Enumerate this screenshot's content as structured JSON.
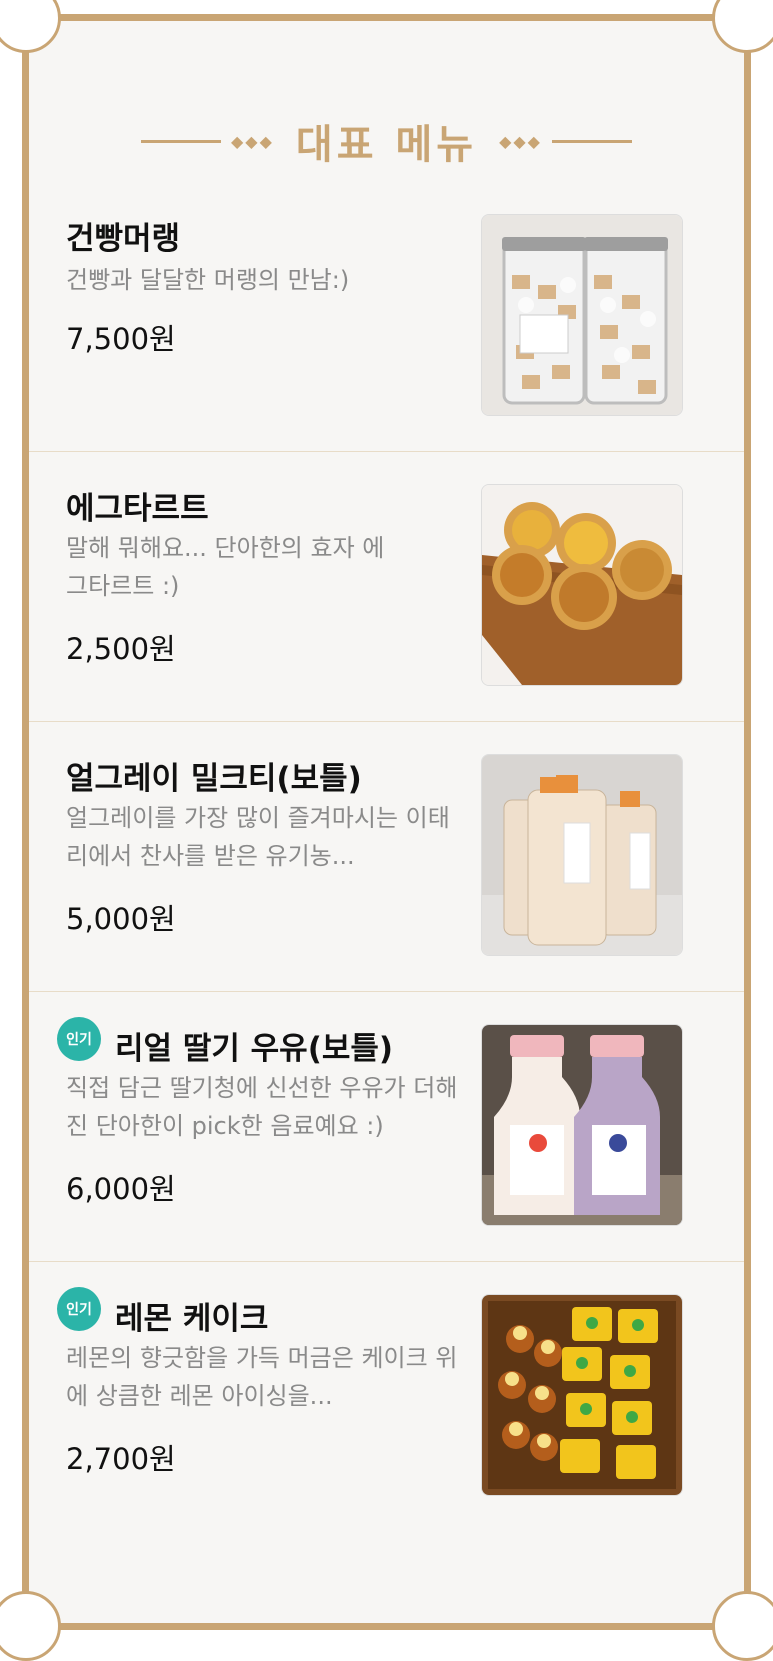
{
  "header": {
    "title": "대표 메뉴",
    "ornament_left": "◆◆◆",
    "ornament_right": "◆◆◆"
  },
  "badge_label": "인기",
  "items": [
    {
      "name": "건빵머랭",
      "desc": "건빵과 달달한 머랭의 만남:)",
      "price": "7,500원",
      "badge": "",
      "photo": "jars-of-meringue-cookies"
    },
    {
      "name": "에그타르트",
      "desc": "말해 뭐해요... 단아한의 효자 에그타르트 :)",
      "price": "2,500원",
      "badge": "",
      "photo": "egg-tarts-on-board"
    },
    {
      "name": "얼그레이 밀크티(보틀)",
      "desc": "얼그레이를 가장 많이 즐겨마시는 이태리에서 찬사를 받은 유기농...",
      "price": "5,000원",
      "badge": "",
      "photo": "milk-tea-bottles"
    },
    {
      "name": "리얼 딸기 우유(보틀)",
      "desc": "직접 담근 딸기청에 신선한 우유가 더해진 단아한이 pick한 음료예요 :)",
      "price": "6,000원",
      "badge": "인기",
      "photo": "strawberry-milk-bottles"
    },
    {
      "name": "레몬 케이크",
      "desc": "레몬의 향긋함을 가득 머금은 케이크 위에 상큼한 레몬 아이싱을...",
      "price": "2,700원",
      "badge": "인기",
      "photo": "lemon-cakes-box"
    }
  ],
  "colors": {
    "gold": "#c9a574",
    "badge": "#2bb4a8"
  }
}
